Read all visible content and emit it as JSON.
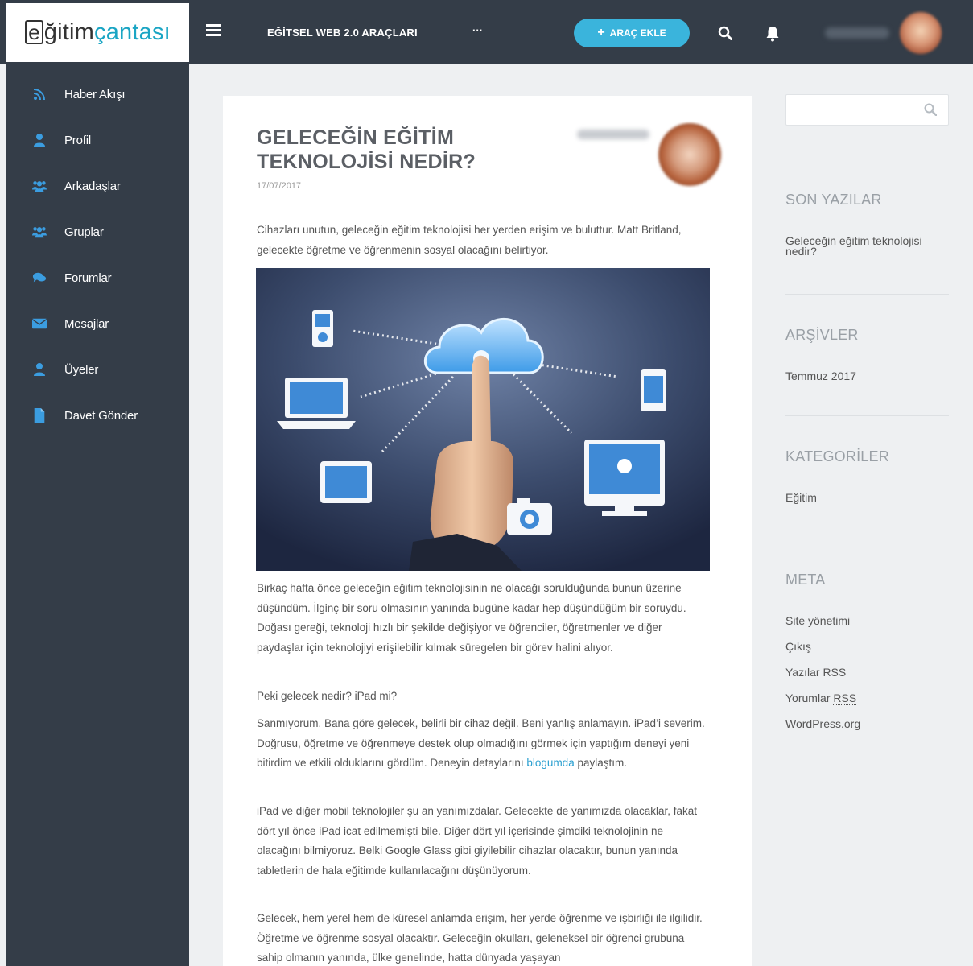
{
  "header": {
    "logo": {
      "part1": "e",
      "part2": "ğitim",
      "part3": "çantası"
    },
    "nav_title": "EĞİTSEL WEB 2.0 ARAÇLARI",
    "nav_more": "···",
    "add_button": "ARAÇ EKLE"
  },
  "sidebar": {
    "items": [
      {
        "label": "Haber Akışı",
        "icon": "rss-icon"
      },
      {
        "label": "Profil",
        "icon": "user-icon"
      },
      {
        "label": "Arkadaşlar",
        "icon": "users-icon"
      },
      {
        "label": "Gruplar",
        "icon": "users-icon"
      },
      {
        "label": "Forumlar",
        "icon": "comments-icon"
      },
      {
        "label": "Mesajlar",
        "icon": "envelope-icon"
      },
      {
        "label": "Üyeler",
        "icon": "user-icon"
      },
      {
        "label": "Davet Gönder",
        "icon": "document-icon"
      }
    ]
  },
  "article": {
    "title": "GELECEĞİN EĞİTİM TEKNOLOJİSİ NEDİR?",
    "date": "17/07/2017",
    "intro": "Cihazları unutun, geleceğin eğitim teknolojisi her yerden erişim ve buluttur. Matt Britland, gelecekte öğretme ve öğrenmenin sosyal olacağını belirtiyor.",
    "p1": "Birkaç hafta önce geleceğin eğitim teknolojisinin ne olacağı sorulduğunda bunun üzerine düşündüm. İlginç bir soru olmasının yanında bugüne kadar hep düşündüğüm bir soruydu. Doğası gereği, teknoloji hızlı bir şekilde değişiyor ve öğrenciler, öğretmenler ve diğer paydaşlar için teknolojiyi erişilebilir kılmak süregelen bir görev halini alıyor.",
    "p2": "Peki gelecek nedir? iPad mi?",
    "p3_before": "Sanmıyorum. Bana göre gelecek, belirli bir cihaz değil. Beni yanlış anlamayın. iPad’i severim. Doğrusu, öğretme ve öğrenmeye destek olup olmadığını görmek için yaptığım deneyi yeni bitirdim ve etkili olduklarını gördüm. Deneyin detaylarını ",
    "p3_link": "blogumda",
    "p3_after": " paylaştım.",
    "p4": "iPad ve diğer mobil teknolojiler şu an yanımızdalar. Gelecekte de yanımızda olacaklar, fakat dört yıl önce iPad icat edilmemişti bile. Diğer dört yıl içerisinde şimdiki teknolojinin ne olacağını bilmiyoruz. Belki Google Glass gibi giyilebilir cihazlar olacaktır, bunun yanında tabletlerin de hala eğitimde kullanılacağını düşünüyorum.",
    "p5": "Gelecek, hem yerel hem de küresel anlamda erişim, her yerde öğrenme ve işbirliği ile ilgilidir. Öğretme ve öğrenme sosyal olacaktır. Geleceğin okulları, geleneksel bir öğrenci grubuna sahip olmanın yanında, ülke genelinde, hatta dünyada yaşayan"
  },
  "widgets": {
    "recent_title": "SON YAZILAR",
    "recent_items": [
      "Geleceğin eğitim teknolojisi nedir?"
    ],
    "archives_title": "ARŞİVLER",
    "archives_items": [
      "Temmuz 2017"
    ],
    "categories_title": "KATEGORİLER",
    "categories_items": [
      "Eğitim"
    ],
    "meta_title": "META",
    "meta": {
      "site_admin": "Site yönetimi",
      "logout": "Çıkış",
      "posts_prefix": "Yazılar",
      "comments_prefix": "Yorumlar",
      "rss": "RSS",
      "wordpress": "WordPress.org"
    }
  },
  "colors": {
    "dark": "#343d48",
    "accent": "#3ab4dc",
    "link": "#2a9fd0",
    "icon_blue": "#3b9de0"
  }
}
